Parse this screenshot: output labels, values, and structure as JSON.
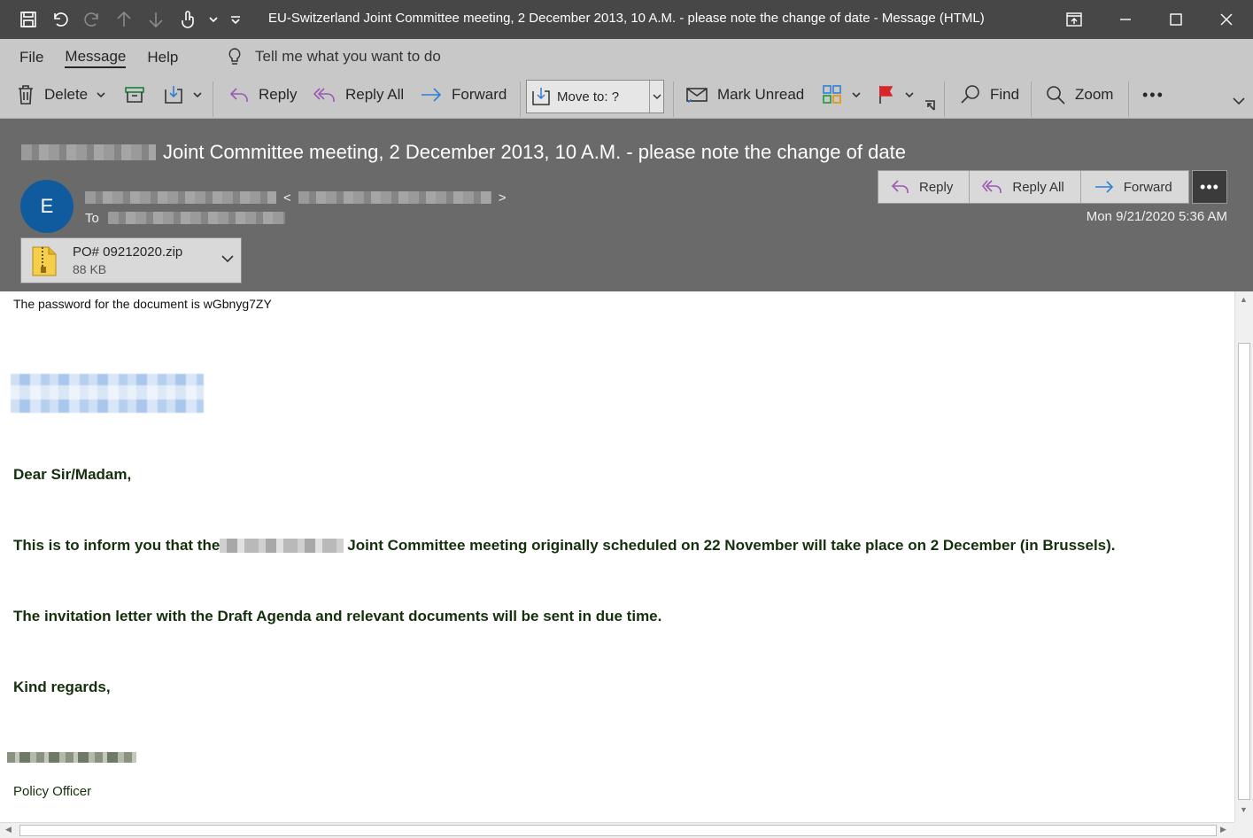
{
  "window": {
    "title": "EU-Switzerland Joint Committee meeting, 2 December 2013, 10 A.M. - please note the change of date  -  Message (HTML)"
  },
  "ribbon": {
    "tabs": [
      "File",
      "Message",
      "Help"
    ],
    "active_tab": "Message",
    "tell_me": "Tell me what you want to do",
    "buttons": {
      "delete": "Delete",
      "reply": "Reply",
      "reply_all": "Reply All",
      "forward": "Forward",
      "move_to": "Move to: ?",
      "mark_unread": "Mark Unread",
      "find": "Find",
      "zoom": "Zoom"
    }
  },
  "message": {
    "subject": "Joint Committee meeting, 2 December 2013, 10 A.M. - please note the change of date",
    "avatar_initial": "E",
    "to_label": "To",
    "date": "Mon 9/21/2020 5:36 AM",
    "actions": {
      "reply": "Reply",
      "reply_all": "Reply All",
      "forward": "Forward"
    },
    "attachment": {
      "name": "PO# 09212020.zip",
      "size": "88 KB"
    }
  },
  "body": {
    "password_line": "The password for the document is wGbnyg7ZY",
    "greeting": "Dear Sir/Madam,",
    "para1_prefix": "This is to inform you that the",
    "para1_suffix": "Joint Committee meeting originally scheduled on 22 November will take place on 2 December (in Brussels).",
    "para2": "The invitation letter with the Draft Agenda and relevant documents will be sent in due time.",
    "closing": "Kind regards,",
    "role": "Policy Officer"
  },
  "colors": {
    "titlebar": "#474747",
    "ribbon": "#c8c8c8",
    "header": "#6a6a6a",
    "avatar": "#0f5b9e",
    "body_text": "#14300c",
    "reply_icon": "#9b59b6",
    "forward_icon": "#2f7fd6",
    "flag": "#d9252a"
  }
}
